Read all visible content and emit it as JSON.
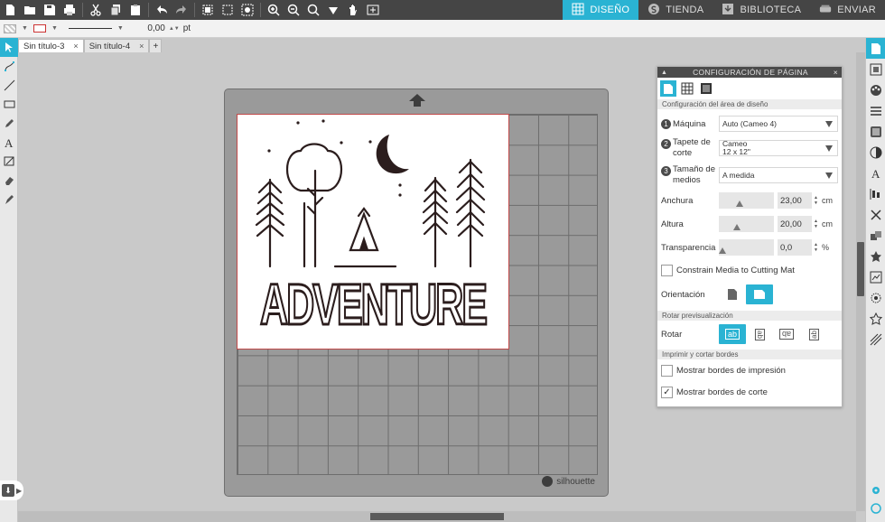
{
  "nav": {
    "tabs": [
      {
        "label": "DISEÑO",
        "icon": "grid-icon",
        "active": true
      },
      {
        "label": "TIENDA",
        "icon": "silhouette-s-icon",
        "active": false
      },
      {
        "label": "BIBLIOTECA",
        "icon": "library-download-icon",
        "active": false
      },
      {
        "label": "ENVIAR",
        "icon": "cutter-icon",
        "active": false
      }
    ]
  },
  "linebar": {
    "line_width": "0,00",
    "unit": "pt"
  },
  "documents": {
    "tabs": [
      {
        "label": "Sin título-3",
        "active": true
      },
      {
        "label": "Sin título-4",
        "active": false
      }
    ],
    "close_glyph": "×",
    "add_glyph": "+"
  },
  "mat": {
    "brand": "silhouette",
    "design_text": "ADVENTURE"
  },
  "panel": {
    "title": "CONFIGURACIÓN DE PÁGINA",
    "close": "×",
    "area_section": "Configuración del área de diseño",
    "machine": {
      "num": "1",
      "label": "Máquina",
      "value": "Auto (Cameo 4)"
    },
    "mat": {
      "num": "2",
      "label1": "Tapete de",
      "label2": "corte",
      "value1": "Cameo",
      "value2": "12 x 12\""
    },
    "media": {
      "num": "3",
      "label1": "Tamaño de",
      "label2": "medios",
      "value": "A medida"
    },
    "width": {
      "label": "Anchura",
      "value": "23,00",
      "unit": "cm",
      "fraction": 0.35
    },
    "height": {
      "label": "Altura",
      "value": "20,00",
      "unit": "cm",
      "fraction": 0.3
    },
    "transparency": {
      "label": "Transparencia",
      "value": "0,0",
      "unit": "%",
      "fraction": 0.0
    },
    "constrain": {
      "label": "Constrain Media to Cutting Mat",
      "checked": false
    },
    "orientation": {
      "label": "Orientación"
    },
    "rotate_section": "Rotar previsualización",
    "rotate": {
      "label": "Rotar",
      "options": [
        "ab",
        "ab",
        "ab",
        "ab"
      ]
    },
    "borders_section": "Imprimir y cortar bordes",
    "print_borders": {
      "label": "Mostrar bordes de impresión",
      "checked": false
    },
    "cut_borders": {
      "label": "Mostrar bordes de corte",
      "checked": true,
      "glyph": "✓"
    }
  },
  "colors": {
    "accent": "#2ab3d3",
    "toolbar": "#454545",
    "design": "#2b1d1d",
    "page_border": "#c04848"
  }
}
